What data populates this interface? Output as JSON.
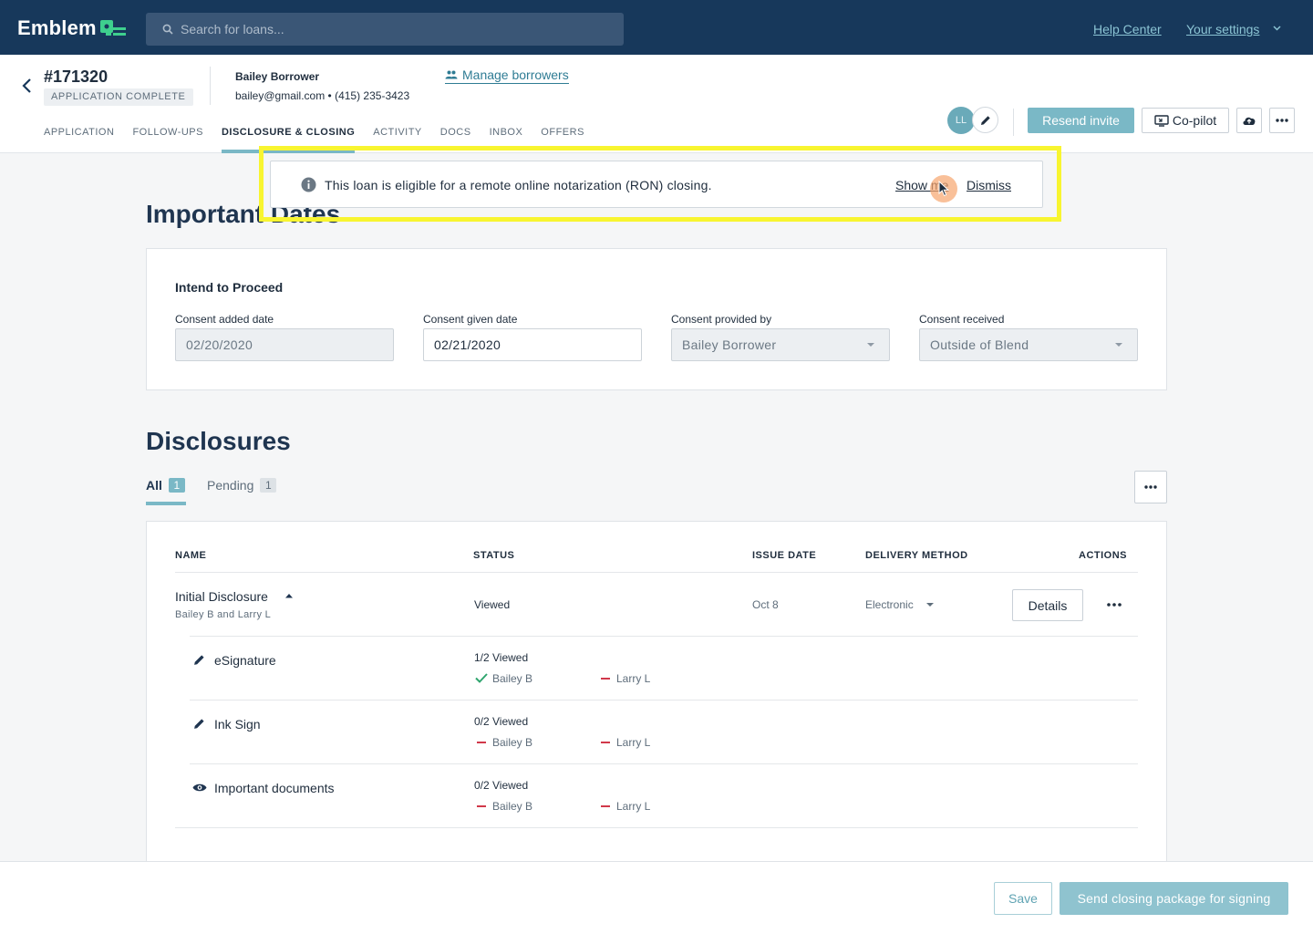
{
  "topbar": {
    "brand": "Emblem",
    "search_placeholder": "Search for loans...",
    "help_center": "Help Center",
    "your_settings": "Your settings"
  },
  "header": {
    "loan_number": "#171320",
    "loan_status": "APPLICATION COMPLETE",
    "borrower_name": "Bailey Borrower",
    "borrower_contact": "bailey@gmail.com • (415) 235-3423",
    "manage_borrowers": "Manage borrowers",
    "tabs": [
      "APPLICATION",
      "FOLLOW-UPS",
      "DISCLOSURE & CLOSING",
      "ACTIVITY",
      "DOCS",
      "INBOX",
      "OFFERS"
    ],
    "active_tab": "DISCLOSURE & CLOSING",
    "avatar_initials": "LL",
    "resend_invite": "Resend invite",
    "copilot": "Co-pilot"
  },
  "banner": {
    "message": "This loan is eligible for a remote online notarization (RON) closing.",
    "show_me": "Show me",
    "dismiss": "Dismiss"
  },
  "important_dates": {
    "heading": "Important Dates",
    "card_title": "Intend to Proceed",
    "fields": [
      {
        "label": "Consent added date",
        "value": "02/20/2020"
      },
      {
        "label": "Consent given date",
        "value": "02/21/2020"
      },
      {
        "label": "Consent provided by",
        "value": "Bailey Borrower"
      },
      {
        "label": "Consent received",
        "value": "Outside of Blend"
      }
    ]
  },
  "disclosures": {
    "heading": "Disclosures",
    "tabs": [
      {
        "label": "All",
        "count": "1"
      },
      {
        "label": "Pending",
        "count": "1"
      }
    ],
    "columns": [
      "NAME",
      "STATUS",
      "ISSUE DATE",
      "DELIVERY METHOD",
      "ACTIONS"
    ],
    "disclosure": {
      "name": "Initial Disclosure",
      "recipients": "Bailey B and Larry L",
      "status": "Viewed",
      "issue_date": "Oct 8",
      "delivery_method": "Electronic",
      "details_label": "Details"
    },
    "items": [
      {
        "name": "eSignature",
        "icon": "pencil-icon",
        "status": "1/2 Viewed",
        "signers": [
          {
            "name": "Bailey B",
            "state": "viewed"
          },
          {
            "name": "Larry L",
            "state": "pending"
          }
        ]
      },
      {
        "name": "Ink Sign",
        "icon": "pencil-icon",
        "status": "0/2 Viewed",
        "signers": [
          {
            "name": "Bailey B",
            "state": "pending"
          },
          {
            "name": "Larry L",
            "state": "pending"
          }
        ]
      },
      {
        "name": "Important documents",
        "icon": "eye-icon",
        "status": "0/2 Viewed",
        "signers": [
          {
            "name": "Bailey B",
            "state": "pending"
          },
          {
            "name": "Larry L",
            "state": "pending"
          }
        ]
      }
    ]
  },
  "footer": {
    "save": "Save",
    "send": "Send closing package for signing"
  },
  "colors": {
    "navy": "#17385b",
    "accent": "#7ab8c6",
    "highlight": "#f8f530",
    "pending_dash": "#d1384a",
    "viewed_check": "#2fa56e"
  }
}
